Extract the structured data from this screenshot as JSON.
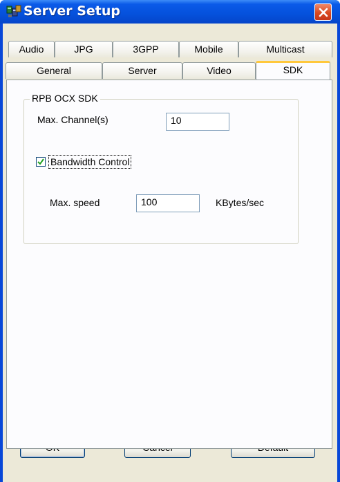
{
  "window": {
    "title": "Server Setup",
    "icon": "server-setup-app-icon",
    "close_icon": "close-x-icon",
    "accent": "#0551dc",
    "close_color": "#d9491f"
  },
  "tabs": {
    "row1": [
      {
        "label": "Audio"
      },
      {
        "label": "JPG"
      },
      {
        "label": "3GPP"
      },
      {
        "label": "Mobile"
      },
      {
        "label": "Multicast"
      }
    ],
    "row2": [
      {
        "label": "General"
      },
      {
        "label": "Server"
      },
      {
        "label": "Video"
      },
      {
        "label": "SDK",
        "selected": true
      }
    ],
    "selected_color": "#ffc83c"
  },
  "sdk": {
    "group_title": "RPB OCX SDK",
    "max_channels_label": "Max. Channel(s)",
    "max_channels_value": "10",
    "bandwidth_control_label": "Bandwidth Control",
    "bandwidth_control_checked": true,
    "max_speed_label": "Max. speed",
    "max_speed_value": "100",
    "max_speed_unit": "KBytes/sec"
  },
  "buttons": {
    "ok": "OK",
    "cancel": "Cancel",
    "default": "Default"
  }
}
